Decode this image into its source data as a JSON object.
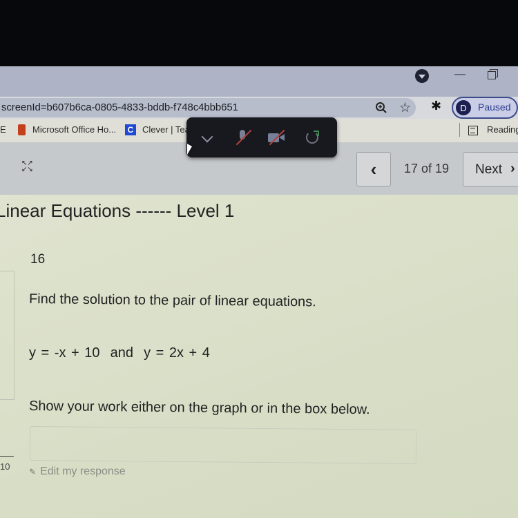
{
  "browser": {
    "url": "screenId=b607b6ca-0805-4833-bddb-f748c4bbb651",
    "profile_initial": "D",
    "profile_status": "Paused",
    "icons": {
      "profile_dropdown": "chevron-down-circle-icon",
      "minimize": "minimize-icon",
      "restore": "restore-icon",
      "zoom": "zoom-in-icon",
      "bookmark": "star-icon",
      "extensions": "puzzle-icon"
    }
  },
  "bookmarks": {
    "items": [
      {
        "label": "E"
      },
      {
        "label": "Microsoft Office Ho...",
        "icon": "microsoft-office-icon"
      },
      {
        "label": "Clever | Tea",
        "icon": "clever-icon",
        "icon_letter": "C"
      }
    ],
    "reading_list": "Reading"
  },
  "meeting_toolbar": {
    "buttons": [
      "chevron-down",
      "mic-muted",
      "video-off",
      "share-screen"
    ]
  },
  "nav": {
    "page_indicator": "17 of 19",
    "prev_label": "‹",
    "next_label": "Next",
    "next_chevron": "›"
  },
  "assignment": {
    "title": "Linear Equations ------ Level 1",
    "question_number": "16",
    "prompt": "Find the solution to the pair of linear equations.",
    "equations": "y = -x + 10  and  y = 2x + 4",
    "instruction": "Show your work either on the graph or in the box below.",
    "response_value": "",
    "edit_label": "Edit my response",
    "side_score": "10"
  },
  "colors": {
    "profile_accent": "#2e3d8e",
    "clever_brand": "#1f49d4",
    "office_brand": "#c4401c",
    "muted_slash": "#b0443c"
  }
}
